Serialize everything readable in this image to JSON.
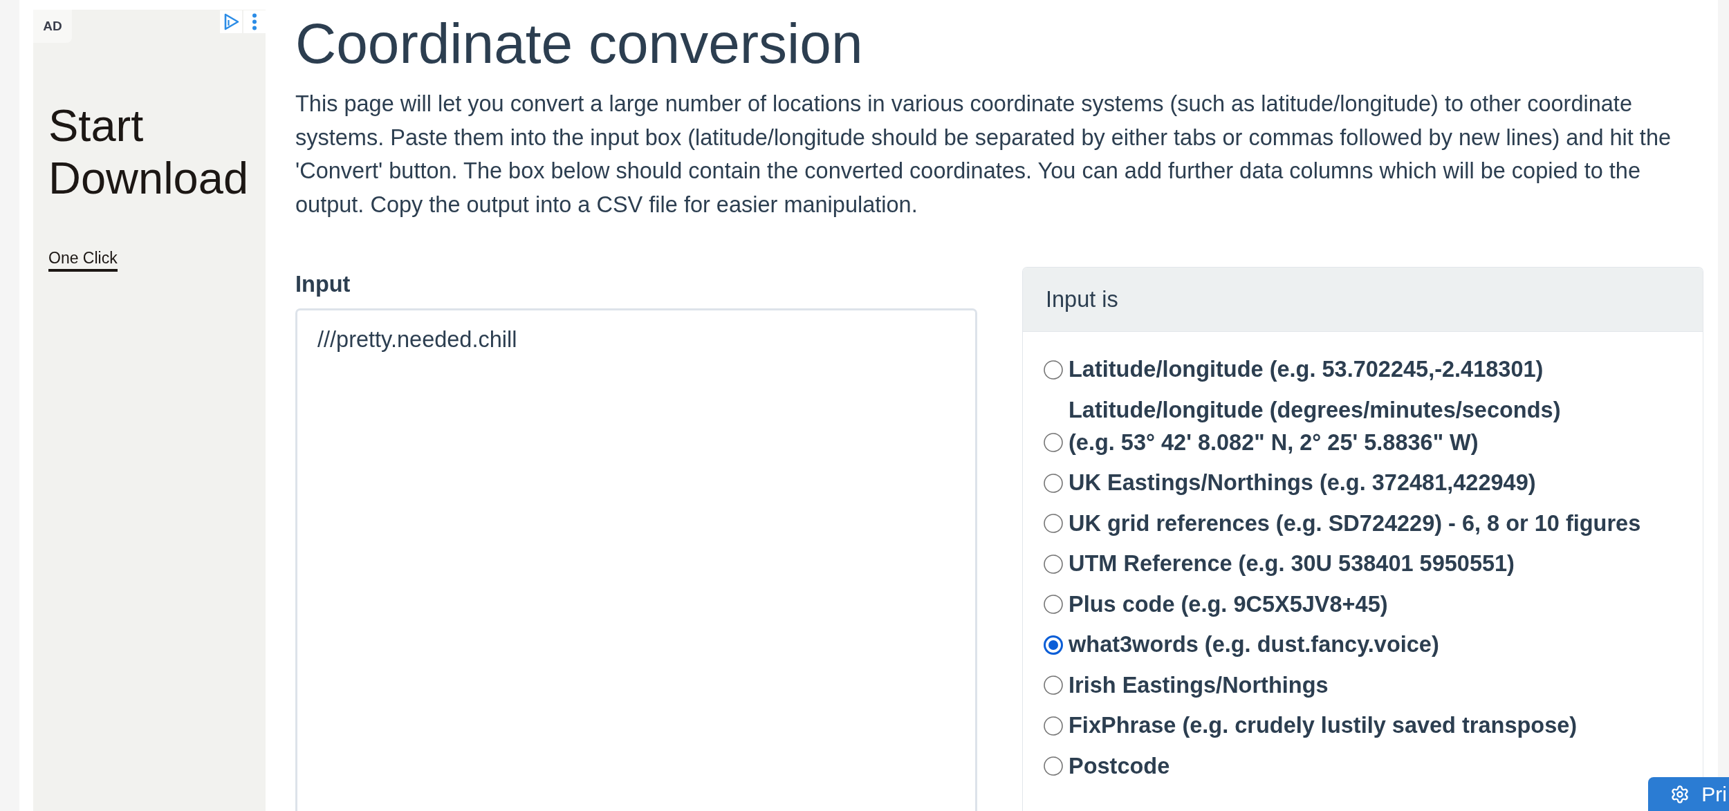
{
  "ad": {
    "badge": "AD",
    "headline": "Start Download",
    "link": "One Click"
  },
  "page": {
    "title": "Coordinate conversion",
    "intro": "This page will let you convert a large number of locations in various coordinate systems (such as latitude/longitude) to other coordinate systems. Paste them into the input box (latitude/longitude should be separated by either tabs or commas followed by new lines) and hit the 'Convert' button. The box below should contain the converted coordinates. You can add further data columns which will be copied to the output. Copy the output into a CSV file for easier manipulation."
  },
  "input": {
    "label": "Input",
    "value": "///pretty.needed.chill"
  },
  "input_type": {
    "title": "Input is",
    "options": [
      {
        "label": "Latitude/longitude (e.g. 53.702245,-2.418301)",
        "selected": false
      },
      {
        "label": "Latitude/longitude (degrees/minutes/seconds)\n(e.g. 53° 42' 8.082\" N, 2° 25' 5.8836\" W)",
        "selected": false
      },
      {
        "label": "UK Eastings/Northings (e.g. 372481,422949)",
        "selected": false
      },
      {
        "label": "UK grid references (e.g. SD724229) - 6, 8 or 10 figures",
        "selected": false
      },
      {
        "label": "UTM Reference (e.g. 30U 538401 5950551)",
        "selected": false
      },
      {
        "label": "Plus code (e.g. 9C5X5JV8+45)",
        "selected": false
      },
      {
        "label": "what3words (e.g. dust.fancy.voice)",
        "selected": true
      },
      {
        "label": "Irish Eastings/Northings",
        "selected": false
      },
      {
        "label": "FixPhrase (e.g. crudely lustily saved transpose)",
        "selected": false
      },
      {
        "label": "Postcode",
        "selected": false
      }
    ]
  },
  "corner_button": {
    "label": "Pri"
  }
}
